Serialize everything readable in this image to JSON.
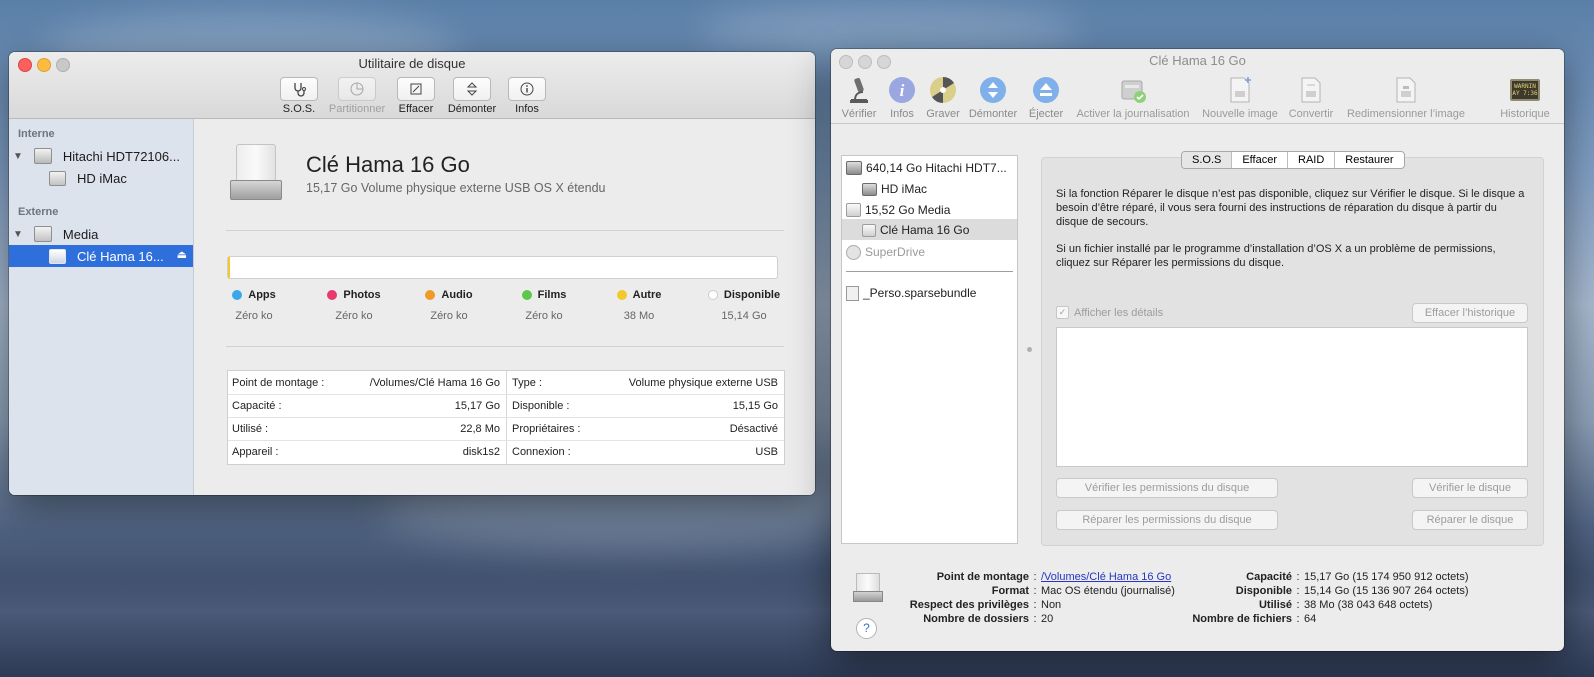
{
  "left_window": {
    "title": "Utilitaire de disque",
    "toolbar": [
      {
        "label": "S.O.S.",
        "enabled": true,
        "icon": "stethoscope-icon"
      },
      {
        "label": "Partitionner",
        "enabled": false,
        "icon": "pie-icon"
      },
      {
        "label": "Effacer",
        "enabled": true,
        "icon": "erase-icon"
      },
      {
        "label": "Démonter",
        "enabled": true,
        "icon": "unmount-icon"
      },
      {
        "label": "Infos",
        "enabled": true,
        "icon": "info-icon"
      }
    ],
    "sidebar": {
      "internal_header": "Interne",
      "external_header": "Externe",
      "disk1": "Hitachi HDT72106...",
      "volume1": "HD iMac",
      "disk2": "Media",
      "volume2": "Clé Hama 16..."
    },
    "volume": {
      "name": "Clé Hama 16 Go",
      "subtitle": "15,17 Go Volume physique externe USB OS X étendu"
    },
    "legend": [
      {
        "name": "Apps",
        "value": "Zéro ko",
        "color": "#3aa8e8"
      },
      {
        "name": "Photos",
        "value": "Zéro ko",
        "color": "#e8386c"
      },
      {
        "name": "Audio",
        "value": "Zéro ko",
        "color": "#f09a28"
      },
      {
        "name": "Films",
        "value": "Zéro ko",
        "color": "#5cc84a"
      },
      {
        "name": "Autre",
        "value": "38 Mo",
        "color": "#f2c928"
      },
      {
        "name": "Disponible",
        "value": "15,14 Go",
        "color": "#ffffff"
      }
    ],
    "info_left": [
      {
        "k": "Point de montage :",
        "v": "/Volumes/Clé Hama 16 Go"
      },
      {
        "k": "Capacité :",
        "v": "15,17 Go"
      },
      {
        "k": "Utilisé :",
        "v": "22,8 Mo"
      },
      {
        "k": "Appareil :",
        "v": "disk1s2"
      }
    ],
    "info_right": [
      {
        "k": "Type :",
        "v": "Volume physique externe USB"
      },
      {
        "k": "Disponible :",
        "v": "15,15 Go"
      },
      {
        "k": "Propriétaires :",
        "v": "Désactivé"
      },
      {
        "k": "Connexion :",
        "v": "USB"
      }
    ]
  },
  "right_window": {
    "title": "Clé Hama 16 Go",
    "toolbar": [
      {
        "label": "Vérifier",
        "icon": "microscope-icon"
      },
      {
        "label": "Infos",
        "icon": "info-icon"
      },
      {
        "label": "Graver",
        "icon": "burn-icon"
      },
      {
        "label": "Démonter",
        "icon": "unmount-icon"
      },
      {
        "label": "Éjecter",
        "icon": "eject-icon"
      },
      {
        "label": "Activer la journalisation",
        "icon": "journal-icon"
      },
      {
        "label": "Nouvelle image",
        "icon": "new-image-icon"
      },
      {
        "label": "Convertir",
        "icon": "convert-icon"
      },
      {
        "label": "Redimensionner l’image",
        "icon": "resize-image-icon"
      },
      {
        "label": "Historique",
        "icon": "log-icon"
      }
    ],
    "log_icon_text": "WARNIN\nAY 7:36",
    "tree": {
      "disk1": "640,14 Go Hitachi HDT7...",
      "vol1": "HD iMac",
      "disk2": "15,52 Go Media",
      "vol2": "Clé Hama 16 Go",
      "superdrive": "SuperDrive",
      "bundle": "_Perso.sparsebundle"
    },
    "tabs": [
      "S.O.S",
      "Effacer",
      "RAID",
      "Restaurer"
    ],
    "help_text_1": "Si la fonction Réparer le disque n’est pas disponible, cliquez sur Vérifier le disque. Si le disque a besoin d’être réparé, il vous sera fourni des instructions de réparation du disque à partir du disque de secours.",
    "help_text_2": "Si un fichier installé par le programme d’installation d’OS X a un problème de permissions, cliquez sur Réparer les permissions du disque.",
    "show_details": "Afficher les détails",
    "clear_history": "Effacer l’historique",
    "verify_permissions": "Vérifier les permissions du disque",
    "verify_disk": "Vérifier le disque",
    "repair_permissions": "Réparer les permissions du disque",
    "repair_disk": "Réparer le disque",
    "info_left": [
      {
        "k": "Point de montage",
        "v": "/Volumes/Clé Hama 16 Go"
      },
      {
        "k": "Format",
        "v": "Mac OS étendu (journalisé)"
      },
      {
        "k": "Respect des privilèges",
        "v": "Non"
      },
      {
        "k": "Nombre de dossiers",
        "v": "20"
      }
    ],
    "info_right": [
      {
        "k": "Capacité",
        "v": "15,17 Go (15 174 950 912 octets)"
      },
      {
        "k": "Disponible",
        "v": "15,14 Go (15 136 907 264 octets)"
      },
      {
        "k": "Utilisé",
        "v": "38 Mo (38 043 648 octets)"
      },
      {
        "k": "Nombre de fichiers",
        "v": "64"
      }
    ],
    "help_button": "?"
  },
  "colors": {
    "selection": "#2f6fdc",
    "sidebar": "#dde3ec"
  }
}
